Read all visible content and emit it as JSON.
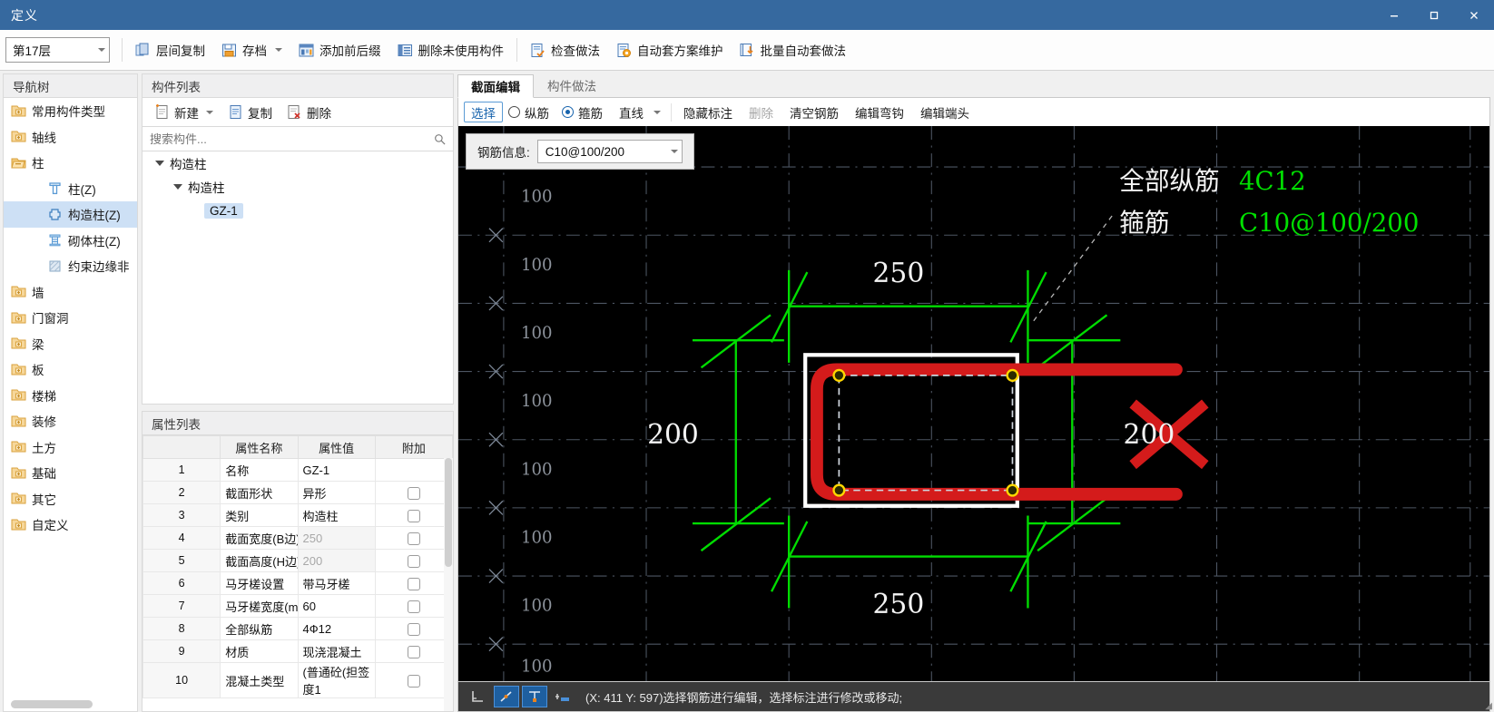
{
  "window": {
    "title": "定义",
    "buttons": {
      "minimize": "minimize-icon",
      "maximize": "maximize-icon",
      "close": "close-icon"
    }
  },
  "toolbar": {
    "floor_selector": "第17层",
    "buttons": [
      {
        "label": "层间复制",
        "icon": "copy-between-floors-icon"
      },
      {
        "label": "存档",
        "icon": "archive-icon",
        "has_dropdown": true
      },
      {
        "label": "添加前后缀",
        "icon": "add-prefix-suffix-icon"
      },
      {
        "label": "删除未使用构件",
        "icon": "delete-unused-icon"
      },
      {
        "label": "检查做法",
        "icon": "check-method-icon"
      },
      {
        "label": "自动套方案维护",
        "icon": "auto-scheme-icon"
      },
      {
        "label": "批量自动套做法",
        "icon": "batch-auto-icon"
      }
    ]
  },
  "nav_tree": {
    "title": "导航树",
    "items": [
      {
        "label": "常用构件类型",
        "icon": "folder-collapsed-icon",
        "level": 0,
        "selected": false
      },
      {
        "label": "轴线",
        "icon": "folder-collapsed-icon",
        "level": 0,
        "selected": false
      },
      {
        "label": "柱",
        "icon": "folder-expanded-icon",
        "level": 0,
        "selected": false
      },
      {
        "label": "柱(Z)",
        "icon": "column-icon",
        "level": 1,
        "selected": false
      },
      {
        "label": "构造柱(Z)",
        "icon": "constructional-column-icon",
        "level": 1,
        "selected": true
      },
      {
        "label": "砌体柱(Z)",
        "icon": "masonry-column-icon",
        "level": 1,
        "selected": false
      },
      {
        "label": "约束边缘非",
        "icon": "edge-member-icon",
        "level": 1,
        "selected": false
      },
      {
        "label": "墙",
        "icon": "folder-collapsed-icon",
        "level": 0,
        "selected": false
      },
      {
        "label": "门窗洞",
        "icon": "folder-collapsed-icon",
        "level": 0,
        "selected": false
      },
      {
        "label": "梁",
        "icon": "folder-collapsed-icon",
        "level": 0,
        "selected": false
      },
      {
        "label": "板",
        "icon": "folder-collapsed-icon",
        "level": 0,
        "selected": false
      },
      {
        "label": "楼梯",
        "icon": "folder-collapsed-icon",
        "level": 0,
        "selected": false
      },
      {
        "label": "装修",
        "icon": "folder-collapsed-icon",
        "level": 0,
        "selected": false
      },
      {
        "label": "土方",
        "icon": "folder-collapsed-icon",
        "level": 0,
        "selected": false
      },
      {
        "label": "基础",
        "icon": "folder-collapsed-icon",
        "level": 0,
        "selected": false
      },
      {
        "label": "其它",
        "icon": "folder-collapsed-icon",
        "level": 0,
        "selected": false
      },
      {
        "label": "自定义",
        "icon": "folder-collapsed-icon",
        "level": 0,
        "selected": false
      }
    ]
  },
  "component_list": {
    "title": "构件列表",
    "toolbar": [
      {
        "label": "新建",
        "icon": "new-icon",
        "has_dropdown": true
      },
      {
        "label": "复制",
        "icon": "copy-icon",
        "has_dropdown": false
      },
      {
        "label": "删除",
        "icon": "delete-icon",
        "has_dropdown": false
      }
    ],
    "search_placeholder": "搜索构件...",
    "search_value": "",
    "search_icon": "search-icon",
    "tree": [
      {
        "label": "构造柱",
        "level": 0,
        "expanded": true,
        "selected": false
      },
      {
        "label": "构造柱",
        "level": 1,
        "expanded": true,
        "selected": false
      },
      {
        "label": "GZ-1",
        "level": 2,
        "expanded": false,
        "selected": true
      }
    ]
  },
  "property_list": {
    "title": "属性列表",
    "headers": [
      "",
      "属性名称",
      "属性值",
      "附加"
    ],
    "rows": [
      {
        "idx": "1",
        "name": "名称",
        "value": "GZ-1",
        "dim": false,
        "attach": false
      },
      {
        "idx": "2",
        "name": "截面形状",
        "value": "异形",
        "dim": false,
        "attach": true
      },
      {
        "idx": "3",
        "name": "类别",
        "value": "构造柱",
        "dim": false,
        "attach": true
      },
      {
        "idx": "4",
        "name": "截面宽度(B边)(...",
        "value": "250",
        "dim": true,
        "attach": true
      },
      {
        "idx": "5",
        "name": "截面高度(H边)(...",
        "value": "200",
        "dim": true,
        "attach": true
      },
      {
        "idx": "6",
        "name": "马牙槎设置",
        "value": "带马牙槎",
        "dim": false,
        "attach": true
      },
      {
        "idx": "7",
        "name": "马牙槎宽度(mm)",
        "value": "60",
        "dim": false,
        "attach": true
      },
      {
        "idx": "8",
        "name": "全部纵筋",
        "value": "4Ф12",
        "dim": false,
        "attach": true
      },
      {
        "idx": "9",
        "name": "材质",
        "value": "现浇混凝土",
        "dim": false,
        "attach": true
      },
      {
        "idx": "10",
        "name": "混凝土类型",
        "value": "(普通砼(担签度1",
        "dim": false,
        "attach": true
      }
    ]
  },
  "right_panel": {
    "tabs": [
      {
        "label": "截面编辑",
        "active": true
      },
      {
        "label": "构件做法",
        "active": false
      }
    ],
    "edit_tools": {
      "select_label": "选择",
      "radios": [
        {
          "label": "纵筋",
          "checked": false
        },
        {
          "label": "箍筋",
          "checked": true
        }
      ],
      "line_mode": "直线",
      "buttons": [
        {
          "label": "隐藏标注",
          "disabled": false
        },
        {
          "label": "删除",
          "disabled": true
        },
        {
          "label": "清空钢筋",
          "disabled": false
        },
        {
          "label": "编辑弯钩",
          "disabled": false
        },
        {
          "label": "编辑端头",
          "disabled": false
        }
      ]
    },
    "rebar_info": {
      "label": "钢筋信息:",
      "value": "C10@100/200"
    },
    "canvas": {
      "annotations": {
        "longitudinal_label": "全部纵筋",
        "longitudinal_value": "4C12",
        "stirrup_label": "箍筋",
        "stirrup_value": "C10@100/200"
      },
      "dimensions": {
        "top": "250",
        "bottom": "250",
        "left": "200",
        "right": "200"
      },
      "grid_labels": [
        "100",
        "100",
        "100",
        "100",
        "100",
        "100",
        "100",
        "100"
      ],
      "colors": {
        "annotation_value": "#00e000",
        "dimension_line": "#00dd00",
        "section_outline": "#ffffff",
        "stirrup": "#d41b1b",
        "rebar_point": "#ffd700",
        "grid": "#505a66",
        "background": "#000000"
      }
    }
  },
  "status_bar": {
    "icons": [
      {
        "name": "ortho-icon",
        "active": false
      },
      {
        "name": "polar-tracking-icon",
        "active": true
      },
      {
        "name": "object-snap-icon",
        "active": true
      },
      {
        "name": "dynamic-input-icon",
        "active": false
      }
    ],
    "coords": "(X: 411 Y: 597)",
    "message": "选择钢筋进行编辑，选择标注进行修改或移动;"
  }
}
